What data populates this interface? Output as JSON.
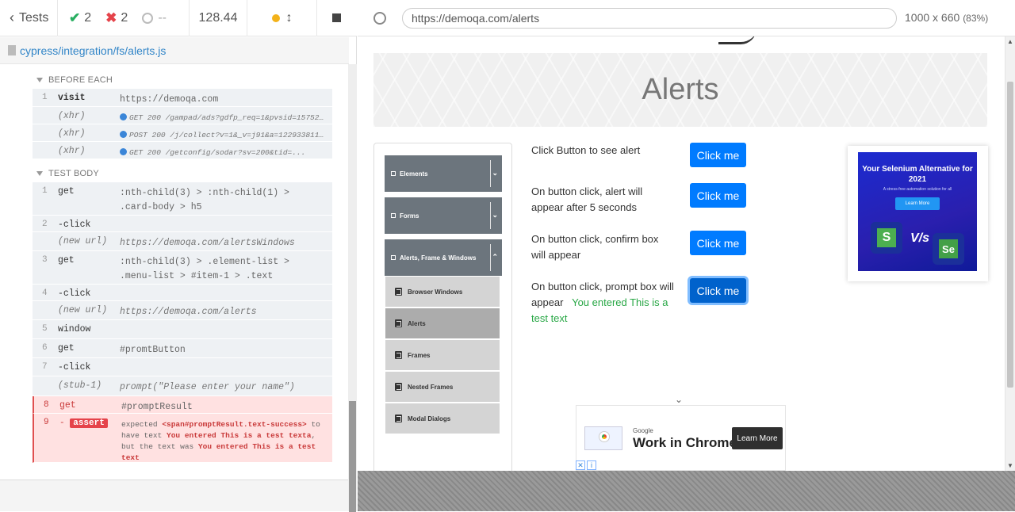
{
  "runner": {
    "tests_label": "Tests",
    "passed": "2",
    "failed": "2",
    "pending": "--",
    "duration": "128.44",
    "spec_path": "cypress/integration/fs/alerts.js"
  },
  "before_each": {
    "title": "BEFORE EACH",
    "commands": [
      {
        "num": "1",
        "name": "visit",
        "msg": "https://demoqa.com"
      },
      {
        "num": "",
        "name": "(xhr)",
        "msg": "GET 200 /gampad/ads?gdfp_req=1&pvsid=157526..."
      },
      {
        "num": "",
        "name": "(xhr)",
        "msg": "POST 200 /j/collect?v=1&_v=j91&a=1229338119..."
      },
      {
        "num": "",
        "name": "(xhr)",
        "msg": "GET 200 /getconfig/sodar?sv=200&tid=..."
      }
    ]
  },
  "test_body": {
    "title": "TEST BODY",
    "commands": [
      {
        "num": "1",
        "name": "get",
        "msg": ":nth-child(3) > :nth-child(1) > .card-body > h5"
      },
      {
        "num": "2",
        "name": "-click",
        "msg": ""
      },
      {
        "num": "",
        "name": "(new url)",
        "msg": "https://demoqa.com/alertsWindows"
      },
      {
        "num": "3",
        "name": "get",
        "msg": ":nth-child(3) > .element-list > .menu-list > #item-1 > .text"
      },
      {
        "num": "4",
        "name": "-click",
        "msg": ""
      },
      {
        "num": "",
        "name": "(new url)",
        "msg": "https://demoqa.com/alerts"
      },
      {
        "num": "5",
        "name": "window",
        "msg": ""
      },
      {
        "num": "6",
        "name": "get",
        "msg": "#promtButton"
      },
      {
        "num": "7",
        "name": "-click",
        "msg": ""
      },
      {
        "num": "",
        "name": "(stub-1)",
        "msg": "prompt(\"Please enter your name\")"
      },
      {
        "num": "8",
        "name": "get",
        "msg": "#promptResult"
      }
    ],
    "assert": {
      "num": "9",
      "name": "-",
      "badge": "assert",
      "p1": "expected",
      "el": "<span#promptResult.text-success>",
      "p2": "to have text",
      "expected": "You entered This is a test texta",
      "p3": ", but the text was",
      "actual": "You entered This is a test text"
    }
  },
  "aut": {
    "url": "https://demoqa.com/alerts",
    "viewport": "1000 x 660",
    "scale": "(83%)",
    "page_title": "Alerts",
    "sidebar": {
      "groups": [
        "Elements",
        "Forms",
        "Alerts, Frame & Windows"
      ],
      "items": [
        "Browser Windows",
        "Alerts",
        "Frames",
        "Nested Frames",
        "Modal Dialogs"
      ]
    },
    "rows": [
      {
        "text": "Click Button to see alert",
        "button": "Click me"
      },
      {
        "text": "On button click, alert will appear after 5 seconds",
        "button": "Click me"
      },
      {
        "text": "On button click, confirm box will appear",
        "button": "Click me"
      },
      {
        "text": "On button click, prompt box will appear",
        "button": "Click me",
        "result": "You entered This is a test text"
      }
    ],
    "ad": {
      "title": "Your Selenium Alternative for 2021",
      "subtitle": "A stress-free automation solution for all",
      "cta": "Learn More"
    },
    "bottom_ad": {
      "brand": "Google",
      "headline": "Work in Chrome",
      "cta": "Learn More"
    }
  },
  "colors": {
    "accent": "#007bff",
    "pass": "#28a745",
    "fail": "#e5434a"
  }
}
